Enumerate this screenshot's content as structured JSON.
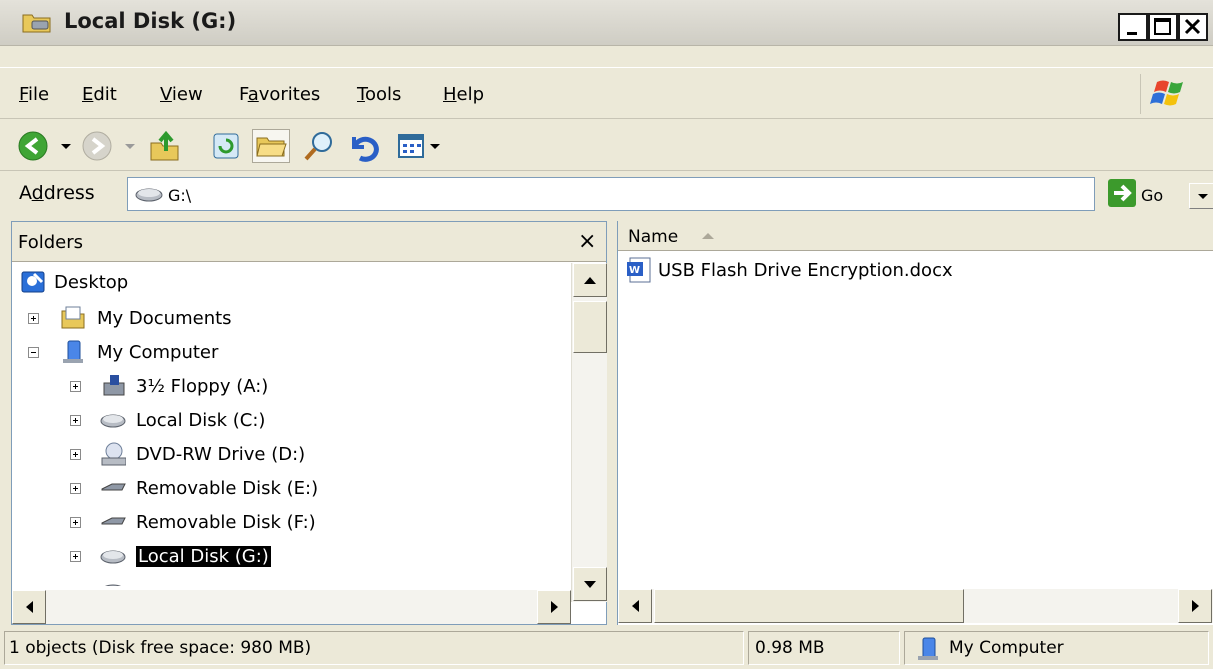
{
  "window": {
    "title": "Local Disk (G:)"
  },
  "menu": [
    {
      "pre": "",
      "u": "F",
      "post": "ile"
    },
    {
      "pre": "",
      "u": "E",
      "post": "dit"
    },
    {
      "pre": "",
      "u": "V",
      "post": "iew"
    },
    {
      "pre": "F",
      "u": "a",
      "post": "vorites"
    },
    {
      "pre": "",
      "u": "T",
      "post": "ools"
    },
    {
      "pre": "",
      "u": "H",
      "post": "elp"
    }
  ],
  "address": {
    "label_pre": "A",
    "label_u": "d",
    "label_post": "dress",
    "value": "G:\\",
    "go_label": "Go"
  },
  "folders": {
    "title": "Folders",
    "close": "×",
    "tree": [
      {
        "label": "Desktop",
        "icon": "desktop-icon"
      },
      {
        "label": "My Documents",
        "icon": "folder-icon"
      },
      {
        "label": "My Computer",
        "icon": "computer-icon"
      },
      {
        "label": "3½ Floppy (A:)",
        "icon": "floppy-icon"
      },
      {
        "label": "Local Disk (C:)",
        "icon": "harddisk-icon"
      },
      {
        "label": "DVD-RW Drive (D:)",
        "icon": "dvd-icon"
      },
      {
        "label": "Removable Disk (E:)",
        "icon": "removable-disk-icon"
      },
      {
        "label": "Removable Disk (F:)",
        "icon": "removable-disk-icon"
      },
      {
        "label": "Local Disk (G:)",
        "icon": "harddisk-icon"
      }
    ]
  },
  "files": {
    "column_name": "Name",
    "items": [
      {
        "label": "USB Flash Drive Encryption.docx",
        "icon": "word-document-icon"
      }
    ]
  },
  "status": {
    "objects": "1 objects (Disk free space: 980 MB)",
    "size": "0.98 MB",
    "zone": "My Computer"
  }
}
